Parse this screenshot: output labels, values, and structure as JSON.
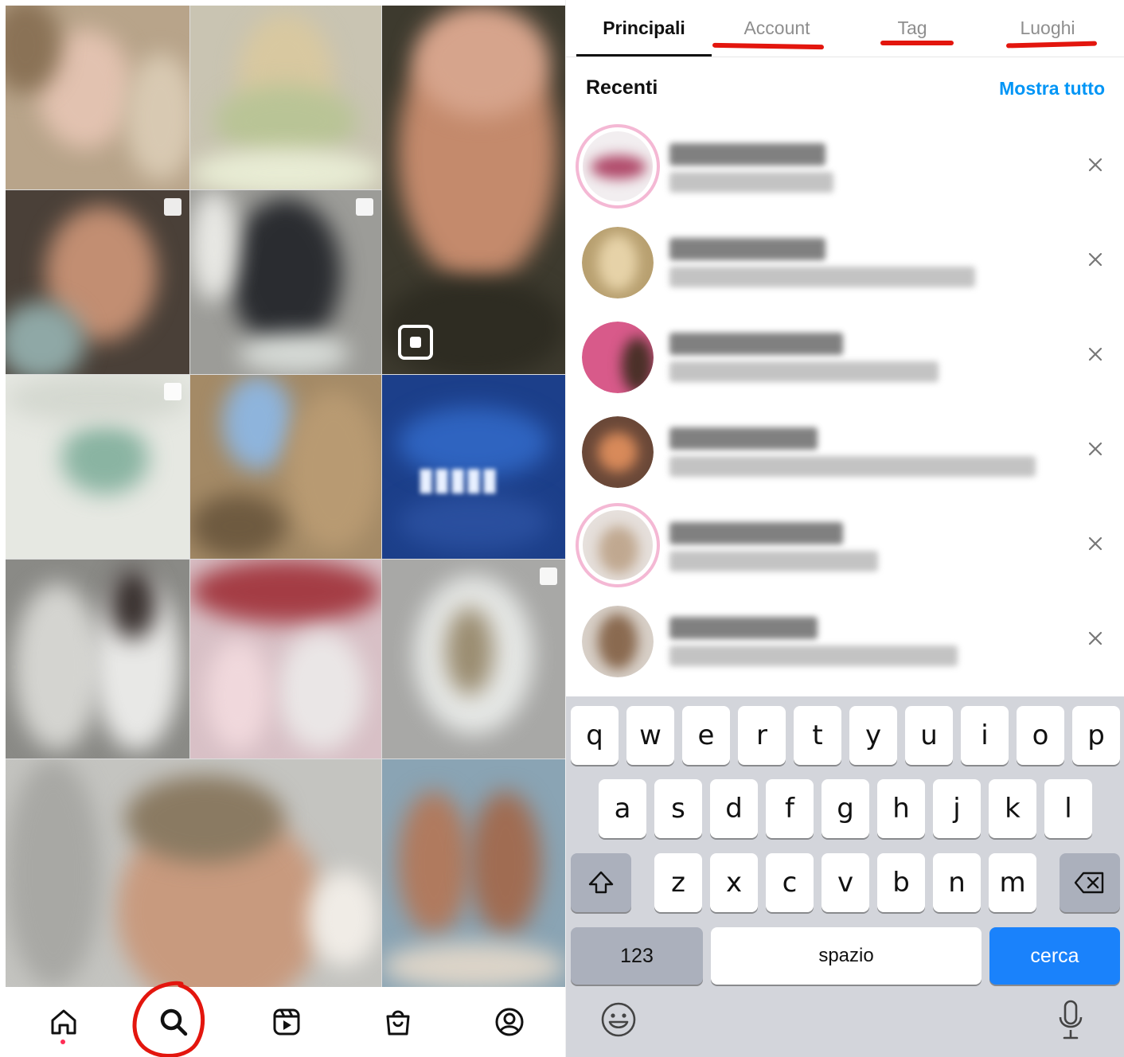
{
  "search_tabs": [
    {
      "label": "Principali",
      "active": true
    },
    {
      "label": "Account",
      "active": false
    },
    {
      "label": "Tag",
      "active": false
    },
    {
      "label": "Luoghi",
      "active": false
    }
  ],
  "recent": {
    "title": "Recenti",
    "show_all": "Mostra tutto",
    "items_count_visible": 6
  },
  "keyboard": {
    "row1": [
      "q",
      "w",
      "e",
      "r",
      "t",
      "y",
      "u",
      "i",
      "o",
      "p"
    ],
    "row2": [
      "a",
      "s",
      "d",
      "f",
      "g",
      "h",
      "j",
      "k",
      "l"
    ],
    "row3": [
      "z",
      "x",
      "c",
      "v",
      "b",
      "n",
      "m"
    ],
    "numbers_key": "123",
    "space_key": "spazio",
    "return_key": "cerca",
    "shift_icon": "shift-icon",
    "backspace_icon": "backspace-icon",
    "emoji_icon": "emoji-icon",
    "mic_icon": "microphone-icon"
  },
  "bottom_nav": [
    "home-icon",
    "search-icon",
    "reels-icon",
    "shop-icon",
    "profile-icon"
  ],
  "colors": {
    "accent_blue": "#0095f6",
    "annotation_red": "#e3160e",
    "return_key_blue": "#1a82fb",
    "keyboard_bg": "#d3d5db"
  }
}
